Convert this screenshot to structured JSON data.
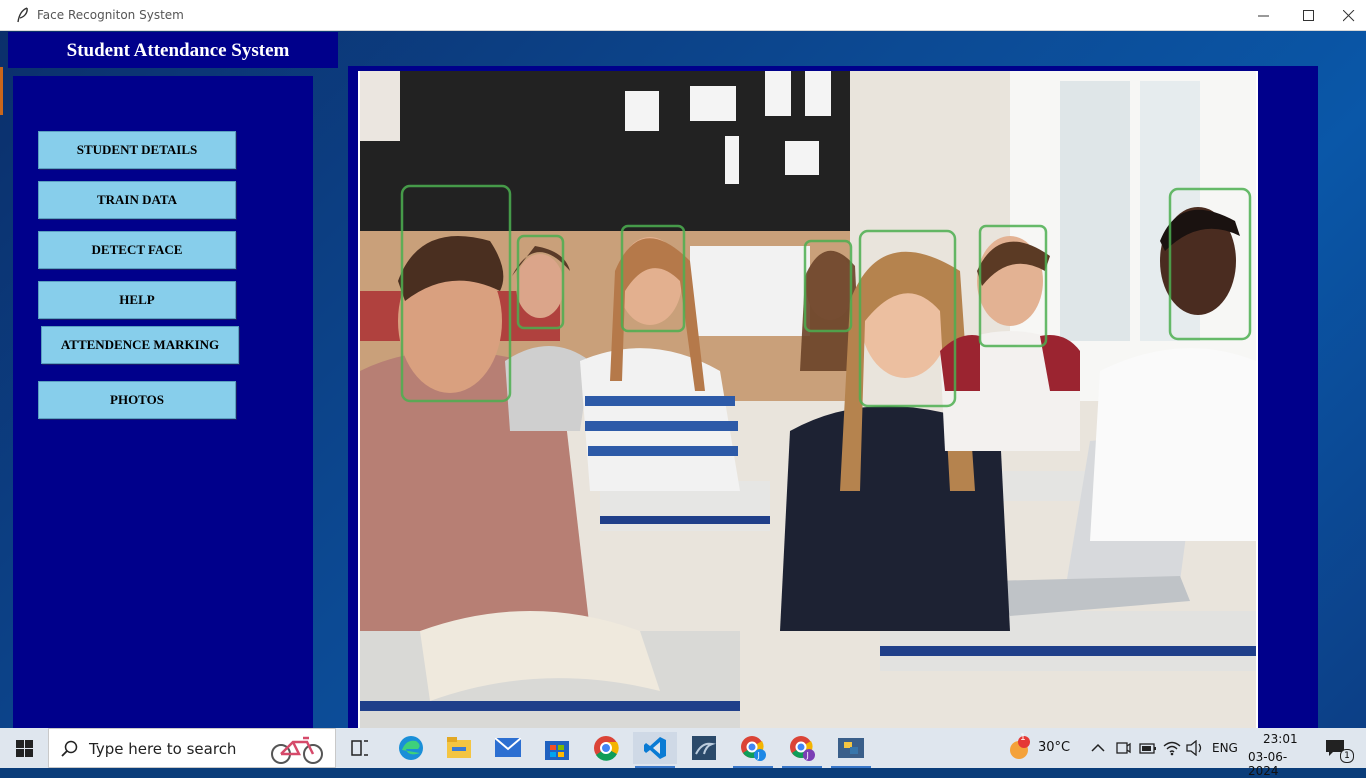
{
  "window": {
    "title": "Face Recogniton System"
  },
  "header": {
    "title": "Student Attendance System"
  },
  "sidebar": {
    "buttons": [
      {
        "label": "STUDENT DETAILS"
      },
      {
        "label": "TRAIN DATA"
      },
      {
        "label": "DETECT FACE"
      },
      {
        "label": "HELP"
      },
      {
        "label": "ATTENDENCE MARKING"
      },
      {
        "label": "PHOTOS"
      }
    ]
  },
  "main": {
    "image": {
      "subject": "classroom students with face detection boxes"
    }
  },
  "taskbar": {
    "search_placeholder": "Type here to search",
    "weather": {
      "temperature": "30°C",
      "alert_count": "1"
    },
    "language": "ENG",
    "clock": {
      "time": "23:01",
      "date": "03-06-2024"
    },
    "notifications_count": "1",
    "pinned_apps": [
      "task-view",
      "edge",
      "file-explorer",
      "mail",
      "store",
      "chrome",
      "vscode",
      "mysql-workbench",
      "chrome-profile-j",
      "chrome-profile-j2",
      "python-idle"
    ]
  },
  "colors": {
    "panel": "#00008b",
    "button": "#87ceeb",
    "face_box": "#4caf50"
  }
}
